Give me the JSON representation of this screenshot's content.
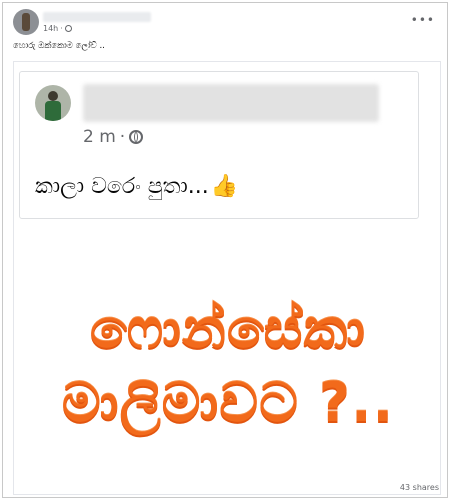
{
  "post": {
    "time": "14h",
    "more_label": "•••",
    "text": "හොරු ඔක්කොම ලෝව් .."
  },
  "shared": {
    "time": "2 m",
    "text": "කාලා වරෙං පුතා...",
    "thumb_emoji": "👍"
  },
  "image_caption": {
    "line1": "ෆොන්සේකා",
    "line2": "මාලිමාවට ?.."
  },
  "footer": {
    "shares": "43 shares"
  }
}
